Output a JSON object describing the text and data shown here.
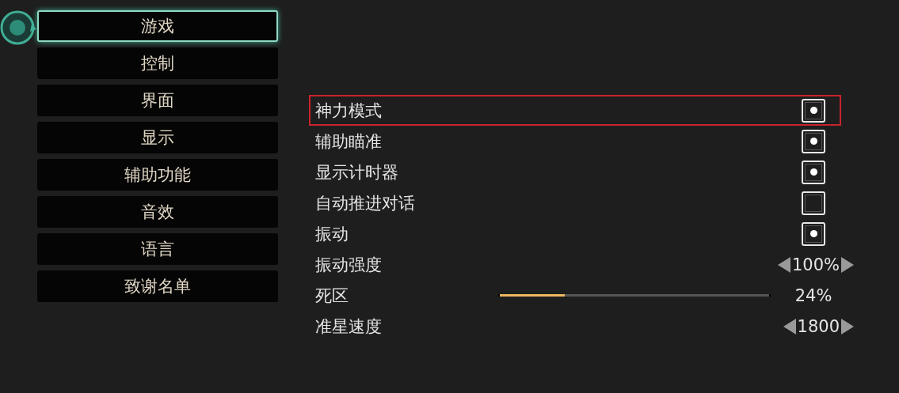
{
  "menu": [
    {
      "label": "游戏",
      "selected": true
    },
    {
      "label": "控制",
      "selected": false
    },
    {
      "label": "界面",
      "selected": false
    },
    {
      "label": "显示",
      "selected": false
    },
    {
      "label": "辅助功能",
      "selected": false
    },
    {
      "label": "音效",
      "selected": false
    },
    {
      "label": "语言",
      "selected": false
    },
    {
      "label": "致谢名单",
      "selected": false
    }
  ],
  "settings": [
    {
      "kind": "toggle",
      "label": "神力模式",
      "checked": true,
      "highlighted": true
    },
    {
      "kind": "toggle",
      "label": "辅助瞄准",
      "checked": true,
      "highlighted": false
    },
    {
      "kind": "toggle",
      "label": "显示计时器",
      "checked": true,
      "highlighted": false
    },
    {
      "kind": "toggle",
      "label": "自动推进对话",
      "checked": false,
      "highlighted": false
    },
    {
      "kind": "toggle",
      "label": "振动",
      "checked": true,
      "highlighted": false
    },
    {
      "kind": "stepper",
      "label": "振动强度",
      "value": "100%",
      "highlighted": false
    },
    {
      "kind": "slider",
      "label": "死区",
      "level": 0.24,
      "reading": "24%",
      "highlighted": false
    },
    {
      "kind": "stepper",
      "label": "准星速度",
      "value": "1800",
      "highlighted": false
    }
  ]
}
